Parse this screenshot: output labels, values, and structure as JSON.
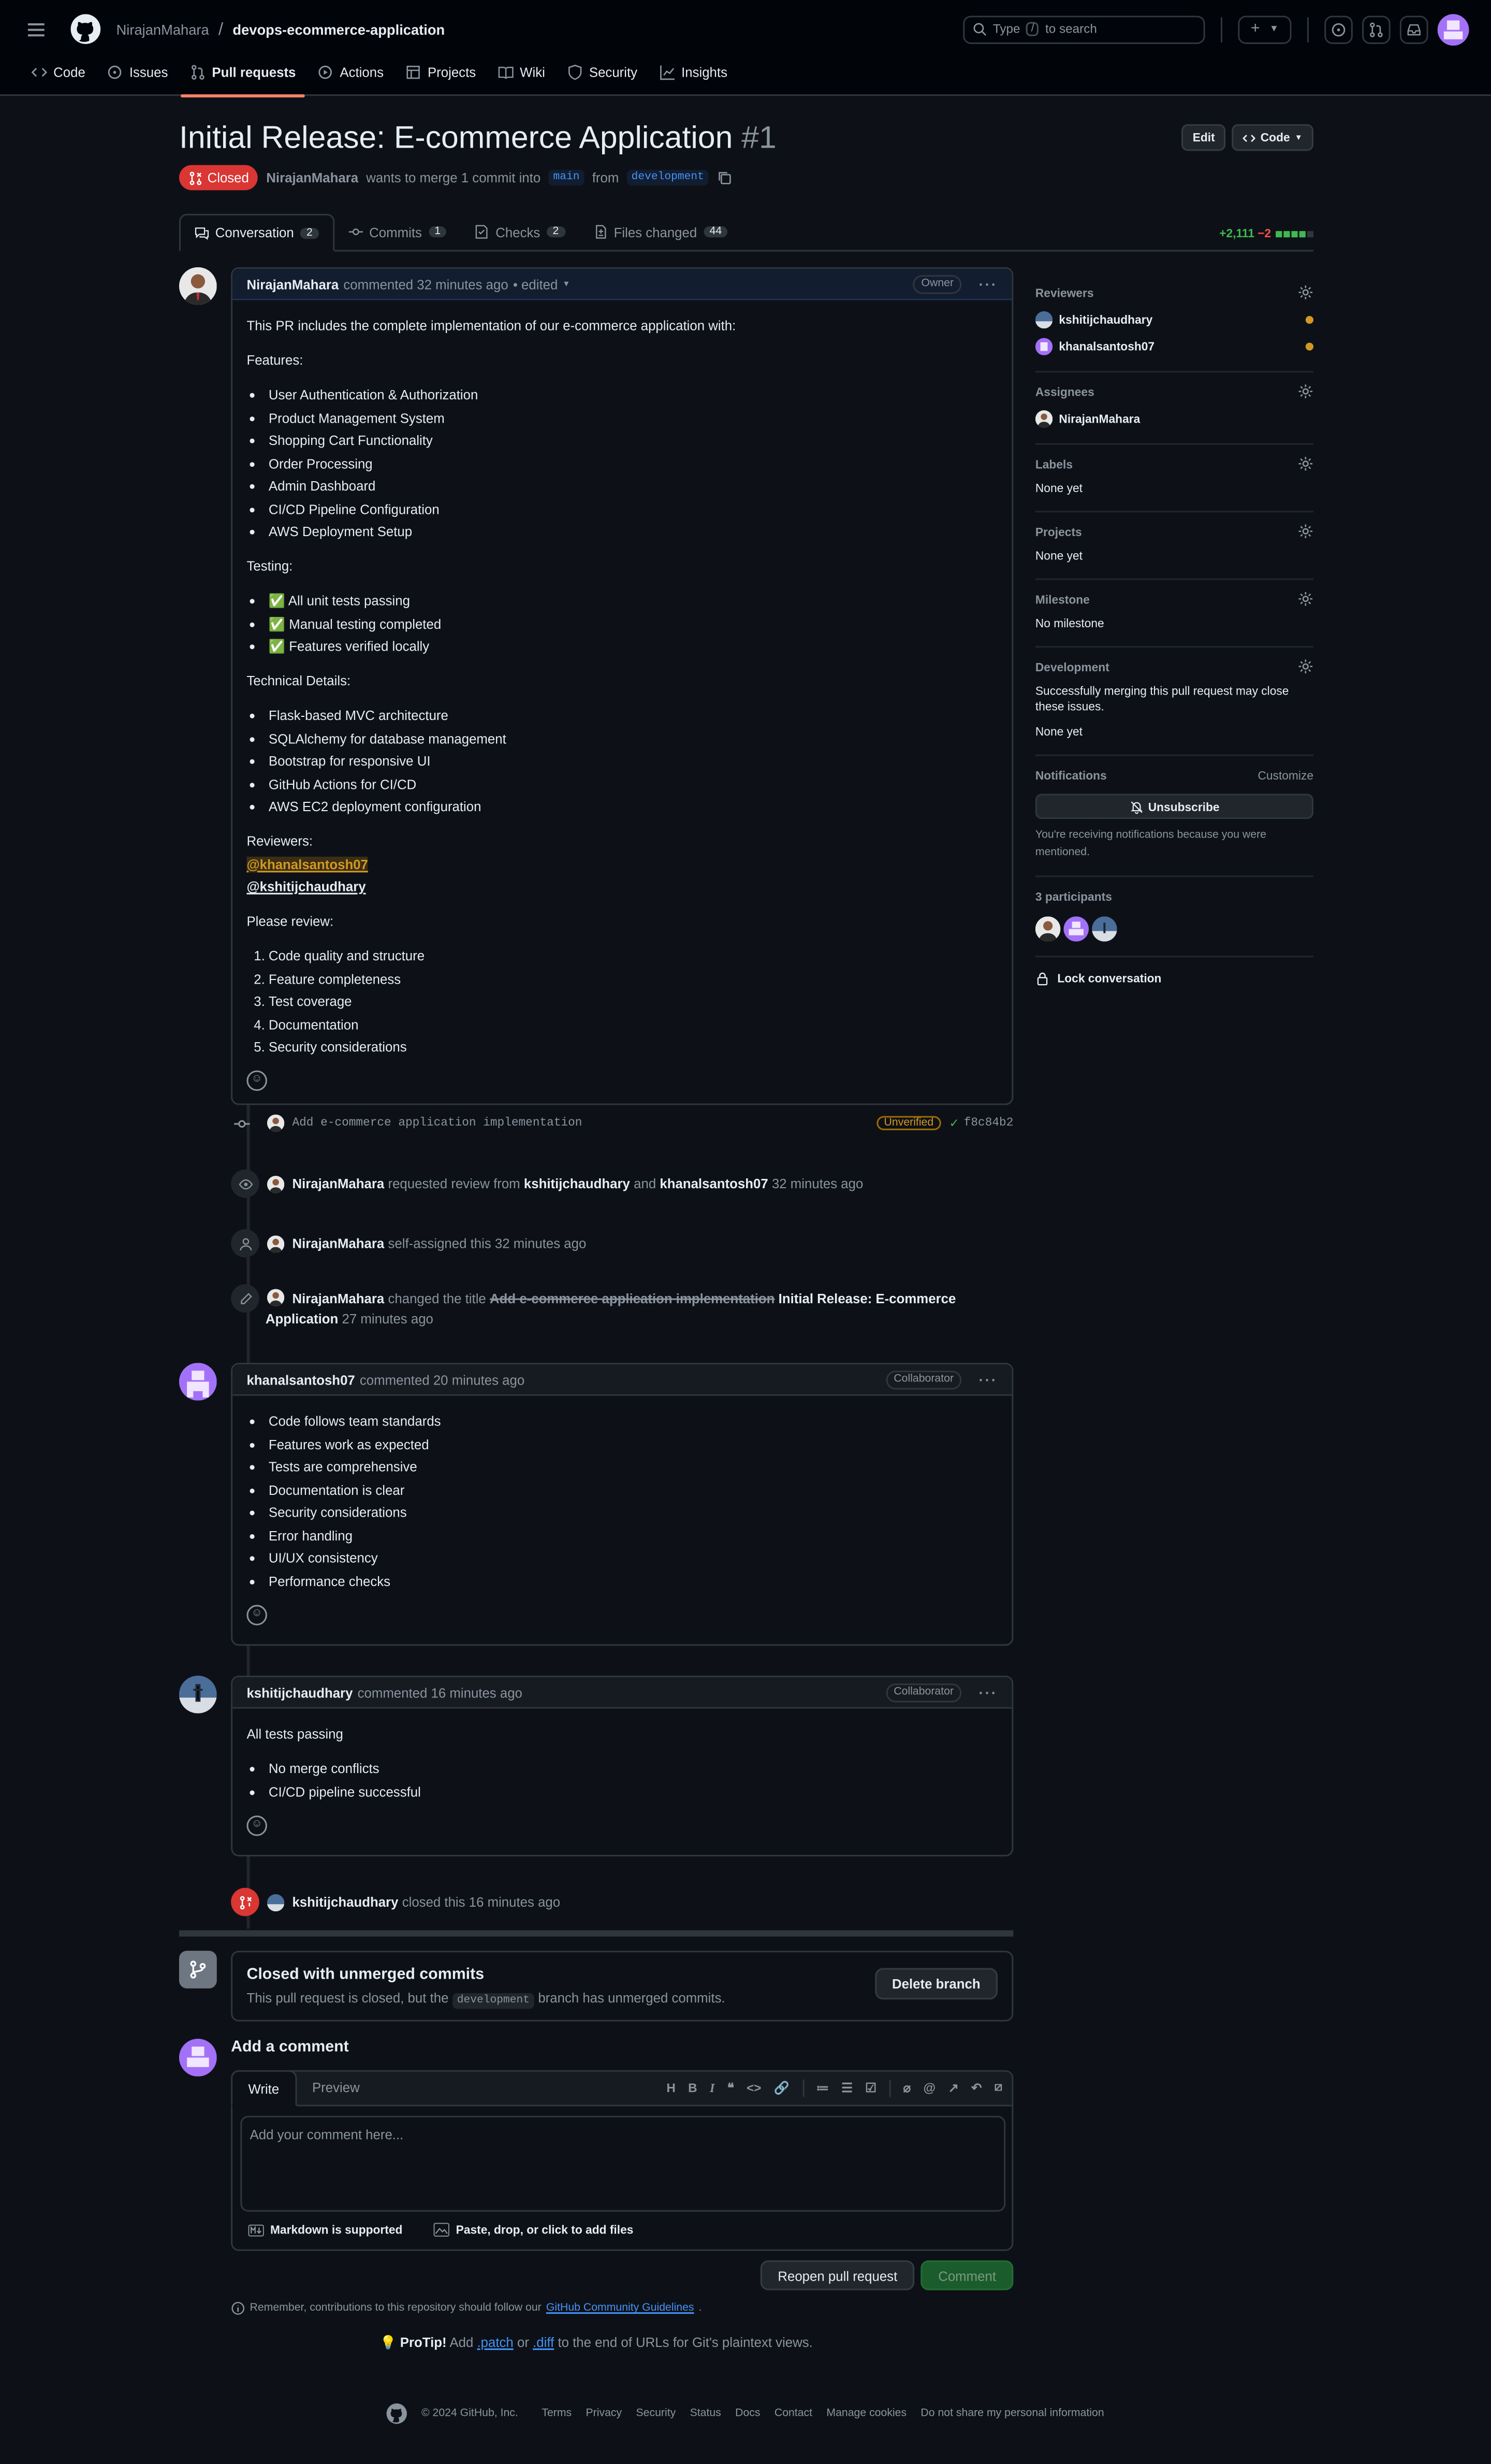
{
  "header": {
    "owner": "NirajanMahara",
    "separator": "/",
    "repo": "devops-ecommerce-application",
    "search_type": "Type",
    "search_key": "/",
    "search_rest": "to search"
  },
  "nav": [
    {
      "label": "Code",
      "icon": "code-icon"
    },
    {
      "label": "Issues",
      "icon": "issue-icon"
    },
    {
      "label": "Pull requests",
      "icon": "pull-request-icon",
      "active": true
    },
    {
      "label": "Actions",
      "icon": "play-icon"
    },
    {
      "label": "Projects",
      "icon": "table-icon"
    },
    {
      "label": "Wiki",
      "icon": "book-icon"
    },
    {
      "label": "Security",
      "icon": "shield-icon"
    },
    {
      "label": "Insights",
      "icon": "graph-icon"
    }
  ],
  "pr": {
    "title": "Initial Release: E-commerce Application",
    "number": "#1",
    "edit_label": "Edit",
    "code_label": "Code",
    "state": "Closed",
    "author": "NirajanMahara",
    "merge_text": "wants to merge 1 commit into",
    "base": "main",
    "from_text": "from",
    "head": "development"
  },
  "tabs": [
    {
      "label": "Conversation",
      "count": "2",
      "icon": "comment-icon"
    },
    {
      "label": "Commits",
      "count": "1",
      "icon": "commit-icon"
    },
    {
      "label": "Checks",
      "count": "2",
      "icon": "checklist-icon"
    },
    {
      "label": "Files changed",
      "count": "44",
      "icon": "file-diff-icon"
    }
  ],
  "diffstat": {
    "additions": "+2,111",
    "deletions": "−2"
  },
  "comment1": {
    "author": "NirajanMahara",
    "meta": "commented 32 minutes ago",
    "edited": "• edited",
    "role": "Owner",
    "intro": "This PR includes the complete implementation of our e-commerce application with:",
    "features_h": "Features:",
    "features": [
      "User Authentication & Authorization",
      "Product Management System",
      "Shopping Cart Functionality",
      "Order Processing",
      "Admin Dashboard",
      "CI/CD Pipeline Configuration",
      "AWS Deployment Setup"
    ],
    "testing_h": "Testing:",
    "testing": [
      "✅ All unit tests passing",
      "✅ Manual testing completed",
      "✅ Features verified locally"
    ],
    "tech_h": "Technical Details:",
    "tech": [
      "Flask-based MVC architecture",
      "SQLAlchemy for database management",
      "Bootstrap for responsive UI",
      "GitHub Actions for CI/CD",
      "AWS EC2 deployment configuration"
    ],
    "reviewers_h": "Reviewers:",
    "mention1": "@khanalsantosh07",
    "mention2": "@kshitijchaudhary",
    "review_h": "Please review:",
    "review": [
      "Code quality and structure",
      "Feature completeness",
      "Test coverage",
      "Documentation",
      "Security considerations"
    ]
  },
  "commit": {
    "message": "Add e-commerce application implementation",
    "badge": "Unverified",
    "sha": "f8c84b2"
  },
  "events": {
    "review_actor": "NirajanMahara",
    "review_text": "requested review from",
    "review_r1": "kshitijchaudhary",
    "review_and": "and",
    "review_r2": "khanalsantosh07",
    "review_time": "32 minutes ago",
    "assign_actor": "NirajanMahara",
    "assign_text": "self-assigned this 32 minutes ago",
    "rename_actor": "NirajanMahara",
    "rename_text": "changed the title",
    "rename_old": "Add e-commerce application implementation",
    "rename_new": "Initial Release: E-commerce Application",
    "rename_time": "27 minutes ago",
    "close_actor": "kshitijchaudhary",
    "close_text": "closed this 16 minutes ago"
  },
  "comment2": {
    "author": "khanalsantosh07",
    "meta": "commented 20 minutes ago",
    "role": "Collaborator",
    "items": [
      "Code follows team standards",
      "Features work as expected",
      "Tests are comprehensive",
      "Documentation is clear",
      "Security considerations",
      "Error handling",
      "UI/UX consistency",
      "Performance checks"
    ]
  },
  "comment3": {
    "author": "kshitijchaudhary",
    "meta": "commented 16 minutes ago",
    "role": "Collaborator",
    "intro": "All tests passing",
    "items": [
      "No merge conflicts",
      "CI/CD pipeline successful"
    ]
  },
  "closed_box": {
    "title": "Closed with unmerged commits",
    "text_a": "This pull request is closed, but the",
    "branch": "development",
    "text_b": "branch has unmerged commits.",
    "button": "Delete branch"
  },
  "add_comment": {
    "title": "Add a comment",
    "tab_write": "Write",
    "tab_preview": "Preview",
    "placeholder": "Add your comment here...",
    "markdown": "Markdown is supported",
    "attach": "Paste, drop, or click to add files",
    "reopen": "Reopen pull request",
    "comment": "Comment",
    "remember_a": "Remember, contributions to this repository should follow our",
    "remember_link": "GitHub Community Guidelines",
    "protip_b": "ProTip!",
    "protip_a": "Add",
    "patch": ".patch",
    "or": "or",
    "diff": ".diff",
    "protip_c": "to the end of URLs for Git's plaintext views."
  },
  "sidebar": {
    "reviewers_h": "Reviewers",
    "reviewer1": "kshitijchaudhary",
    "reviewer2": "khanalsantosh07",
    "assignees_h": "Assignees",
    "assignee": "NirajanMahara",
    "labels_h": "Labels",
    "labels_v": "None yet",
    "projects_h": "Projects",
    "projects_v": "None yet",
    "milestone_h": "Milestone",
    "milestone_v": "No milestone",
    "development_h": "Development",
    "development_note": "Successfully merging this pull request may close these issues.",
    "development_v": "None yet",
    "notifications_h": "Notifications",
    "customize": "Customize",
    "unsubscribe": "Unsubscribe",
    "notif_note": "You're receiving notifications because you were mentioned.",
    "participants_h": "3 participants",
    "lock": "Lock conversation"
  },
  "footer": [
    "© 2024 GitHub, Inc.",
    "Terms",
    "Privacy",
    "Security",
    "Status",
    "Docs",
    "Contact",
    "Manage cookies",
    "Do not share my personal information"
  ],
  "colors": {
    "closed": "#da3633",
    "accent": "#f78166",
    "link": "#4493f8",
    "success": "#238636"
  }
}
